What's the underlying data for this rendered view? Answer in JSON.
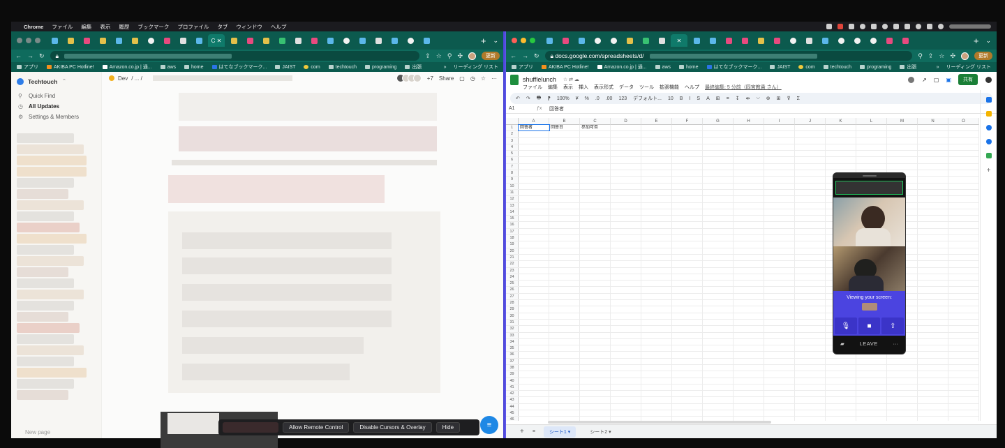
{
  "menubar": {
    "app": "Chrome",
    "items": [
      "ファイル",
      "編集",
      "表示",
      "履歴",
      "ブックマーク",
      "プロファイル",
      "タブ",
      "ウィンドウ",
      "ヘルプ"
    ]
  },
  "left_window": {
    "toolbar": {
      "update": "更新"
    },
    "bookmarks": [
      "アプリ",
      "AKIBA PC Hotline!",
      "Amazon.co.jp | 通...",
      "aws",
      "home",
      "はてなブックマーク...",
      "JAIST",
      "com",
      "techtouch",
      "programing",
      "出張"
    ],
    "bookmarks_right": "リーディング リスト",
    "notion": {
      "workspace": "Techtouch",
      "sidebar_items": [
        "Quick Find",
        "All Updates",
        "Settings & Members"
      ],
      "new_page": "New page",
      "breadcrumb": "Dev",
      "breadcrumb_sep": "/ ... /",
      "members_extra": "+7",
      "share": "Share"
    },
    "remote_bar": {
      "allow": "Allow Remote Control",
      "disable": "Disable Cursors & Overlay",
      "hide": "Hide"
    }
  },
  "right_window": {
    "url": "docs.google.com/spreadsheets/d/",
    "toolbar": {
      "update": "更新"
    },
    "bookmarks": [
      "アプリ",
      "AKIBA PC Hotline!",
      "Amazon.co.jp | 通...",
      "aws",
      "home",
      "はてなブックマーク...",
      "JAIST",
      "com",
      "techtouch",
      "programing",
      "出張"
    ],
    "bookmarks_right": "リーディング リスト",
    "sheets": {
      "title": "shufflelunch",
      "menus": [
        "ファイル",
        "編集",
        "表示",
        "挿入",
        "表示形式",
        "データ",
        "ツール",
        "拡張機能",
        "ヘルプ"
      ],
      "last_edit": "最終編集: 5 分前（四宮教貴 さん）",
      "share": "共有",
      "toolbar": [
        "↶",
        "↷",
        "🖶",
        "⁋",
        "100%",
        "¥",
        "%",
        ".0",
        ".00",
        "123",
        "デフォルト...",
        "10",
        "B",
        "I",
        "S",
        "A",
        "⊞",
        "≡",
        "↧",
        "⇹",
        "⌵",
        "⊕",
        "⊞",
        "⊽",
        "Σ"
      ],
      "name_box": "A1",
      "formula": "回答者",
      "columns": [
        "A",
        "B",
        "C",
        "D",
        "E",
        "F",
        "G",
        "H",
        "I",
        "J",
        "K",
        "L",
        "M",
        "N",
        "O"
      ],
      "row_count": 46,
      "row1": [
        "回答者",
        "回答日",
        "参加可否"
      ],
      "sheet_tabs": [
        "シート1",
        "シート2"
      ]
    },
    "meeting": {
      "viewing": "Viewing your screen:",
      "leave": "LEAVE",
      "more": "···"
    }
  }
}
